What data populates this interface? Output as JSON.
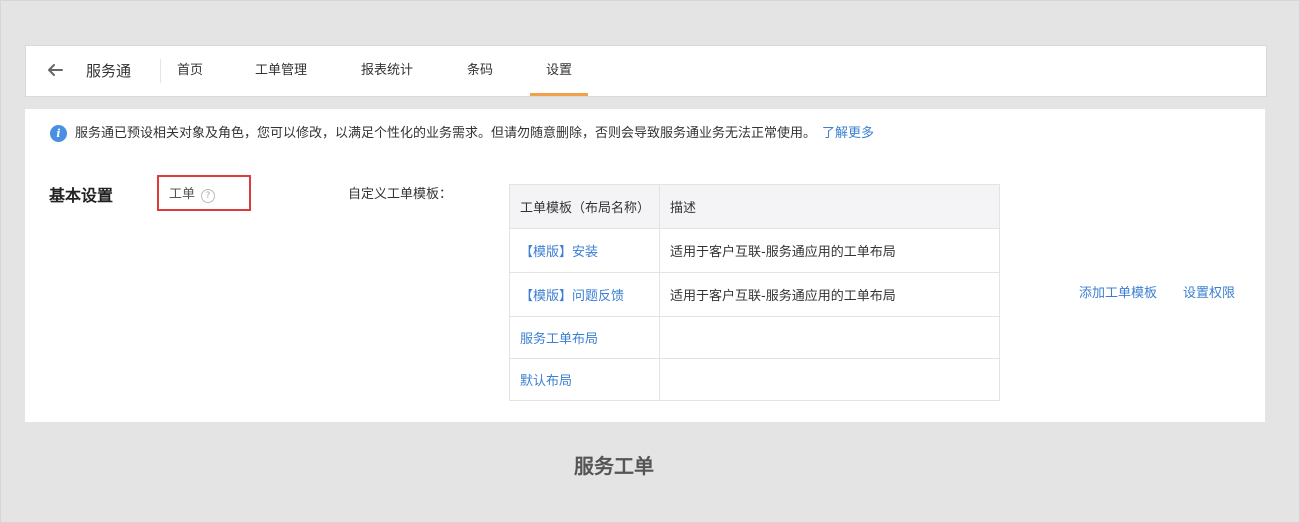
{
  "nav": {
    "app_name": "服务通",
    "tabs": [
      {
        "label": "首页"
      },
      {
        "label": "工单管理"
      },
      {
        "label": "报表统计"
      },
      {
        "label": "条码"
      },
      {
        "label": "设置"
      }
    ],
    "active_tab": "设置",
    "accent_color": "#f0a24a"
  },
  "notice": {
    "text": "服务通已预设相关对象及角色，您可以修改，以满足个性化的业务需求。但请勿随意删除，否则会导致服务通业务无法正常使用。",
    "link_label": "了解更多"
  },
  "settings": {
    "section_title": "基本设置",
    "category_label": "工单",
    "help_glyph": "?",
    "field_label": "自定义工单模板：",
    "table": {
      "headers": [
        "工单模板（布局名称）",
        "描述"
      ],
      "rows": [
        {
          "name": "【模版】安装",
          "description": "适用于客户互联-服务通应用的工单布局"
        },
        {
          "name": "【模版】问题反馈",
          "description": "适用于客户互联-服务通应用的工单布局"
        },
        {
          "name": "服务工单布局",
          "description": ""
        },
        {
          "name": "默认布局",
          "description": ""
        }
      ]
    },
    "actions": {
      "add_template": "添加工单模板",
      "set_permissions": "设置权限"
    }
  },
  "caption": "服务工单",
  "colors": {
    "link": "#3b7fd1",
    "highlight_border": "#e03b3b",
    "info_icon": "#4a90e2"
  }
}
